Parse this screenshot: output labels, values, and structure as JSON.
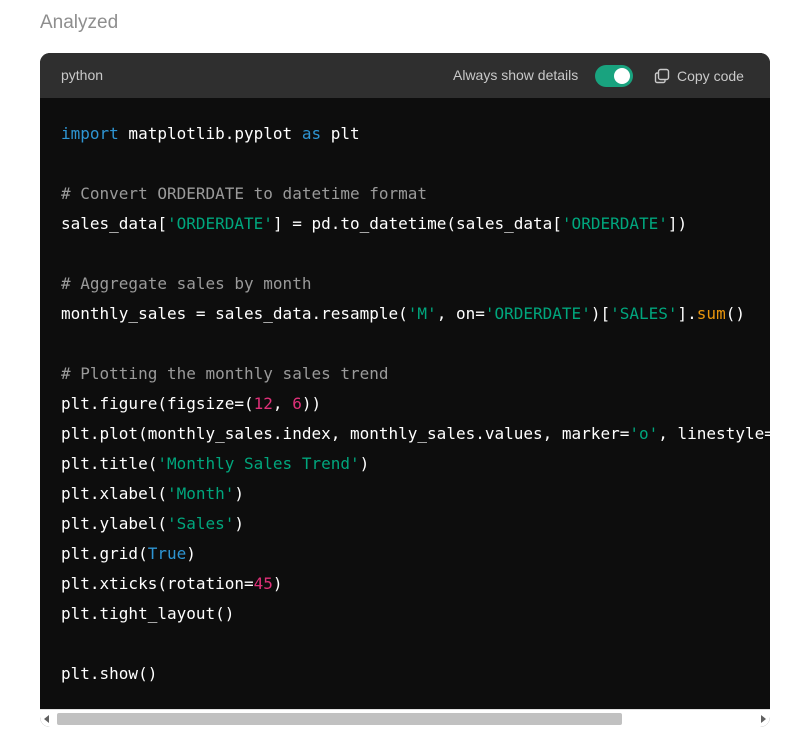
{
  "status": "Analyzed",
  "code_block": {
    "language": "python",
    "toggle_label": "Always show details",
    "toggle_on": true,
    "copy_label": "Copy code",
    "colors": {
      "background": "#0d0d0d",
      "header": "#2f2f2f",
      "keyword": "#2e95d3",
      "comment": "#9a9a9a",
      "string": "#00a67d",
      "number": "#df3079",
      "builtin": "#e9950c",
      "toggle": "#19a37f"
    },
    "lines": [
      [
        {
          "t": "import",
          "c": "kw"
        },
        {
          "t": " matplotlib.pyplot "
        },
        {
          "t": "as",
          "c": "kw"
        },
        {
          "t": " plt"
        }
      ],
      [],
      [
        {
          "t": "# Convert ORDERDATE to datetime format",
          "c": "cm"
        }
      ],
      [
        {
          "t": "sales_data["
        },
        {
          "t": "'ORDERDATE'",
          "c": "st"
        },
        {
          "t": "] = pd.to_datetime(sales_data["
        },
        {
          "t": "'ORDERDATE'",
          "c": "st"
        },
        {
          "t": "])"
        }
      ],
      [],
      [
        {
          "t": "# Aggregate sales by month",
          "c": "cm"
        }
      ],
      [
        {
          "t": "monthly_sales = sales_data.resample("
        },
        {
          "t": "'M'",
          "c": "st"
        },
        {
          "t": ", on="
        },
        {
          "t": "'ORDERDATE'",
          "c": "st"
        },
        {
          "t": ")["
        },
        {
          "t": "'SALES'",
          "c": "st"
        },
        {
          "t": "]."
        },
        {
          "t": "sum",
          "c": "fn"
        },
        {
          "t": "()"
        }
      ],
      [],
      [
        {
          "t": "# Plotting the monthly sales trend",
          "c": "cm"
        }
      ],
      [
        {
          "t": "plt.figure(figsize=("
        },
        {
          "t": "12",
          "c": "nm"
        },
        {
          "t": ", "
        },
        {
          "t": "6",
          "c": "nm"
        },
        {
          "t": "))"
        }
      ],
      [
        {
          "t": "plt.plot(monthly_sales.index, monthly_sales.values, marker="
        },
        {
          "t": "'o'",
          "c": "st"
        },
        {
          "t": ", linestyle="
        }
      ],
      [
        {
          "t": "plt.title("
        },
        {
          "t": "'Monthly Sales Trend'",
          "c": "st"
        },
        {
          "t": ")"
        }
      ],
      [
        {
          "t": "plt.xlabel("
        },
        {
          "t": "'Month'",
          "c": "st"
        },
        {
          "t": ")"
        }
      ],
      [
        {
          "t": "plt.ylabel("
        },
        {
          "t": "'Sales'",
          "c": "st"
        },
        {
          "t": ")"
        }
      ],
      [
        {
          "t": "plt.grid("
        },
        {
          "t": "True",
          "c": "kw"
        },
        {
          "t": ")"
        }
      ],
      [
        {
          "t": "plt.xticks(rotation="
        },
        {
          "t": "45",
          "c": "nm"
        },
        {
          "t": ")"
        }
      ],
      [
        {
          "t": "plt.tight_layout()"
        }
      ],
      [],
      [
        {
          "t": "plt.show()"
        }
      ]
    ]
  }
}
